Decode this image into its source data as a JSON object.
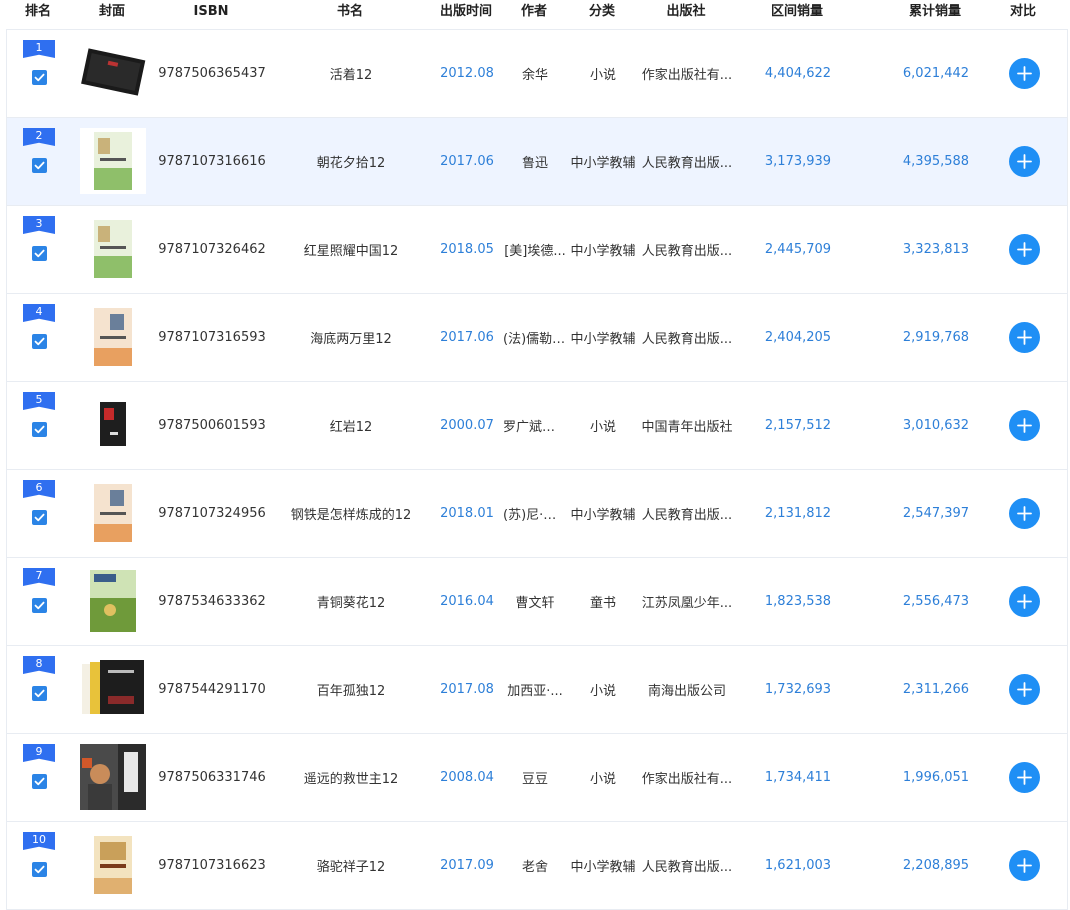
{
  "headers": {
    "rank": "排名",
    "cover": "封面",
    "isbn": "ISBN",
    "title": "书名",
    "date": "出版时间",
    "author": "作者",
    "category": "分类",
    "publisher": "出版社",
    "period_sales": "区间销量",
    "total_sales": "累计销量",
    "compare": "对比"
  },
  "colors": {
    "rank_badge": "#2f6ff0",
    "checkbox": "#2b84e6",
    "compare_button": "#1f8ff5",
    "link_blue": "#2d7fd8",
    "highlight_row": "#eef4ff"
  },
  "rows": [
    {
      "rank": "1",
      "isbn": "9787506365437",
      "title": "活着12",
      "date": "2012.08",
      "author": "余华",
      "category": "小说",
      "publisher": "作家出版社有...",
      "period_sales": "4,404,622",
      "total_sales": "6,021,442",
      "checked": true,
      "cover_icon": "book-cover-dark"
    },
    {
      "rank": "2",
      "isbn": "9787107316616",
      "title": "朝花夕拾12",
      "date": "2017.06",
      "author": "鲁迅",
      "category": "中小学教辅",
      "publisher": "人民教育出版...",
      "period_sales": "3,173,939",
      "total_sales": "4,395,588",
      "checked": true,
      "cover_icon": "book-cover-green"
    },
    {
      "rank": "3",
      "isbn": "9787107326462",
      "title": "红星照耀中国12",
      "date": "2018.05",
      "author": "[美]埃德...",
      "category": "中小学教辅",
      "publisher": "人民教育出版...",
      "period_sales": "2,445,709",
      "total_sales": "3,323,813",
      "checked": true,
      "cover_icon": "book-cover-green"
    },
    {
      "rank": "4",
      "isbn": "9787107316593",
      "title": "海底两万里12",
      "date": "2017.06",
      "author": "(法)儒勒·...",
      "category": "中小学教辅",
      "publisher": "人民教育出版...",
      "period_sales": "2,404,205",
      "total_sales": "2,919,768",
      "checked": true,
      "cover_icon": "book-cover-orange"
    },
    {
      "rank": "5",
      "isbn": "9787500601593",
      "title": "红岩12",
      "date": "2000.07",
      "author": "罗广斌，...",
      "category": "小说",
      "publisher": "中国青年出版社",
      "period_sales": "2,157,512",
      "total_sales": "3,010,632",
      "checked": true,
      "cover_icon": "book-cover-red"
    },
    {
      "rank": "6",
      "isbn": "9787107324956",
      "title": "钢铁是怎样炼成的12",
      "date": "2018.01",
      "author": "(苏)尼·奥...",
      "category": "中小学教辅",
      "publisher": "人民教育出版...",
      "period_sales": "2,131,812",
      "total_sales": "2,547,397",
      "checked": true,
      "cover_icon": "book-cover-orange"
    },
    {
      "rank": "7",
      "isbn": "9787534633362",
      "title": "青铜葵花12",
      "date": "2016.04",
      "author": "曹文轩",
      "category": "童书",
      "publisher": "江苏凤凰少年...",
      "period_sales": "1,823,538",
      "total_sales": "2,556,473",
      "checked": true,
      "cover_icon": "book-cover-field"
    },
    {
      "rank": "8",
      "isbn": "9787544291170",
      "title": "百年孤独12",
      "date": "2017.08",
      "author": "加西亚·...",
      "category": "小说",
      "publisher": "南海出版公司",
      "period_sales": "1,732,693",
      "total_sales": "2,311,266",
      "checked": true,
      "cover_icon": "book-cover-set"
    },
    {
      "rank": "9",
      "isbn": "9787506331746",
      "title": "遥远的救世主12",
      "date": "2008.04",
      "author": "豆豆",
      "category": "小说",
      "publisher": "作家出版社有...",
      "period_sales": "1,734,411",
      "total_sales": "1,996,051",
      "checked": true,
      "cover_icon": "book-cover-portrait"
    },
    {
      "rank": "10",
      "isbn": "9787107316623",
      "title": "骆驼祥子12",
      "date": "2017.09",
      "author": "老舍",
      "category": "中小学教辅",
      "publisher": "人民教育出版...",
      "period_sales": "1,621,003",
      "total_sales": "2,208,895",
      "checked": true,
      "cover_icon": "book-cover-cream"
    }
  ]
}
